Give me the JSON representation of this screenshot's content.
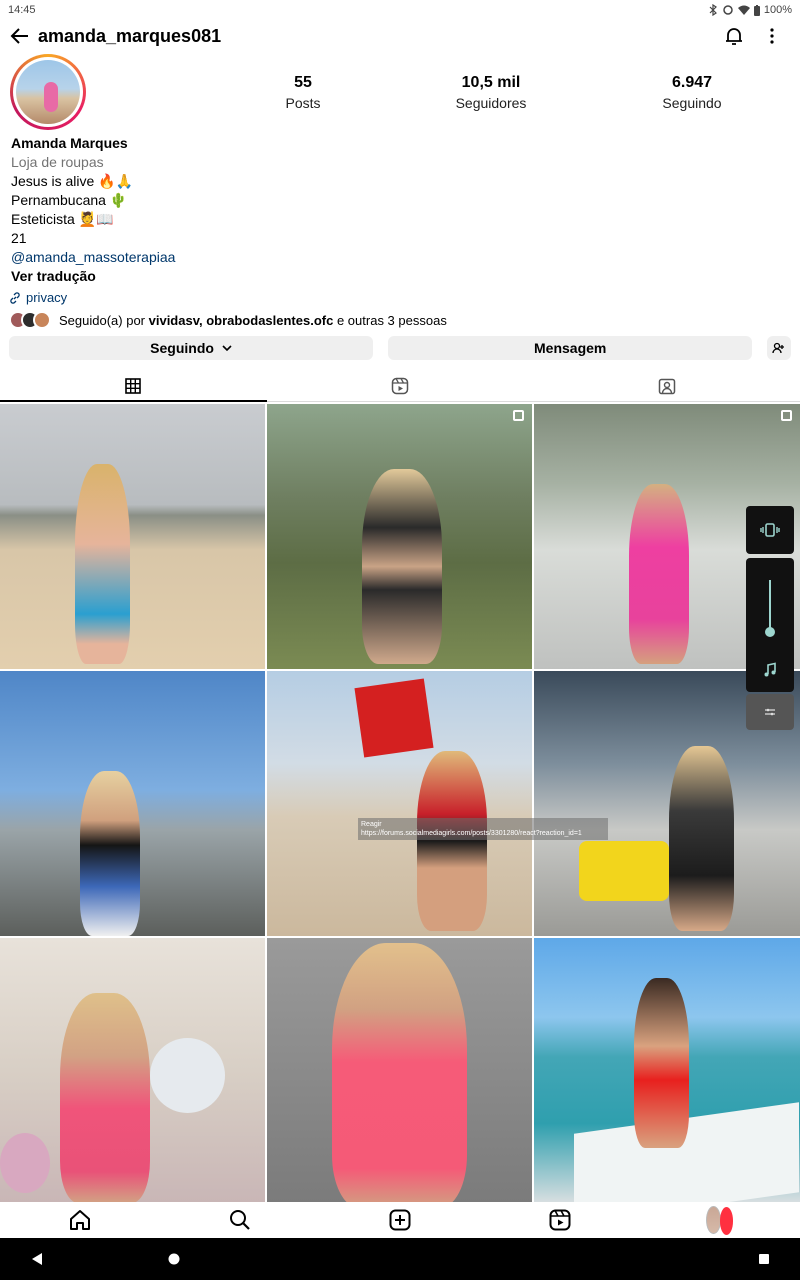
{
  "status_bar": {
    "time": "14:45",
    "battery": "100%"
  },
  "header": {
    "username": "amanda_marques081"
  },
  "stats": [
    {
      "value": "55",
      "label": "Posts"
    },
    {
      "value": "10,5 mil",
      "label": "Seguidores"
    },
    {
      "value": "6.947",
      "label": "Seguindo"
    }
  ],
  "bio": {
    "name": "Amanda Marques",
    "category": "Loja de roupas",
    "line1": "Jesus is alive 🔥🙏",
    "line2": "Pernambucana 🌵",
    "line3": "Esteticista 💆📖",
    "line4": "21",
    "mention": "@amanda_massoterapiaa",
    "translate": "Ver tradução"
  },
  "privacy_link": "privacy",
  "followed_by": {
    "prefix": "Seguido(a) por",
    "users": "vividasv, obrabodaslentes.ofc",
    "suffix": "e outras 3 pessoas"
  },
  "actions": {
    "following_label": "Seguindo",
    "message_label": "Mensagem"
  },
  "tooltip": {
    "title": "Reagir",
    "url": "https://forums.socialmediagirls.com/posts/3301280/react?reaction_id=1"
  },
  "colors": {
    "link": "#00376b",
    "button_bg": "#efefef",
    "notification_dot": "#ff3040",
    "ring_start": "#f9a825",
    "ring_end": "#c2185b"
  }
}
